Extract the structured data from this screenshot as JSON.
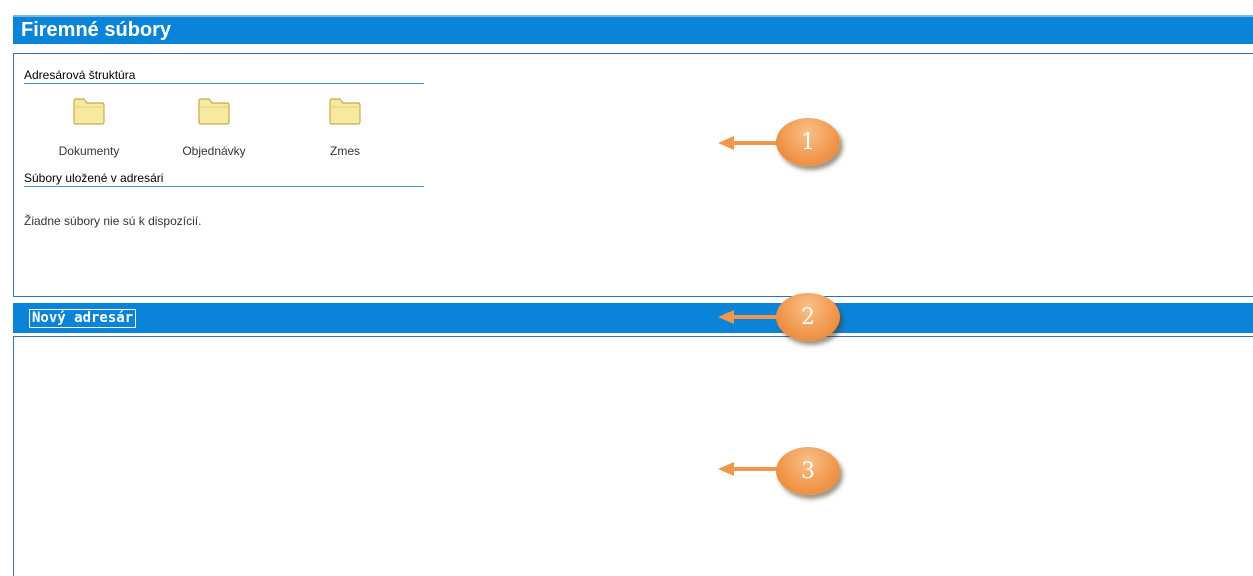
{
  "header": {
    "title": "Firemné súbory"
  },
  "panel": {
    "dir_section_title": "Adresárová štruktúra",
    "folders": [
      {
        "label": "Dokumenty",
        "icon": "folder-icon"
      },
      {
        "label": "Objednávky",
        "icon": "folder-icon"
      },
      {
        "label": "Zmes",
        "icon": "folder-icon"
      }
    ],
    "files_section_title": "Súbory uložené v adresári",
    "no_files_text": "Žiadne súbory nie sú k dispozícií."
  },
  "toolbar": {
    "new_dir_label": "Nový adresár"
  },
  "callouts": [
    {
      "number": "1"
    },
    {
      "number": "2"
    },
    {
      "number": "3"
    }
  ],
  "colors": {
    "bar_blue": "#0a84d9",
    "border_blue": "#2f6fcf",
    "callout_orange": "#f1964a",
    "folder_yellow": "#f6e9a0"
  }
}
